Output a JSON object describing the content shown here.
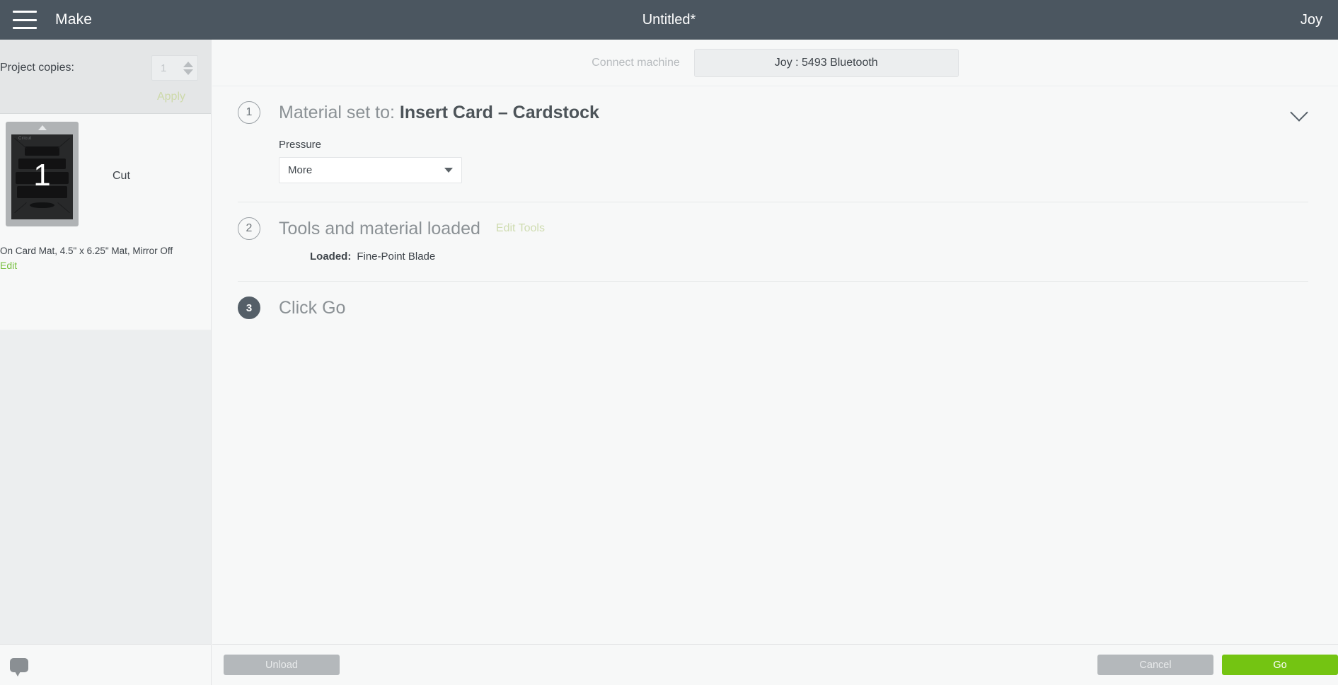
{
  "topbar": {
    "menu_icon": "hamburger-icon",
    "app_title": "Make",
    "document_title": "Untitled*",
    "machine_name": "Joy"
  },
  "left_panel": {
    "copies_label": "Project copies:",
    "copies_value": "1",
    "apply_label": "Apply",
    "mat": {
      "number": "1",
      "operation": "Cut",
      "brand": "Cricut",
      "description": "On Card Mat, 4.5\" x 6.25\" Mat, Mirror Off",
      "edit_label": "Edit"
    },
    "chat_icon": "chat-bubble-icon"
  },
  "connect": {
    "label": "Connect machine",
    "selected_machine": "Joy : 5493 Bluetooth"
  },
  "steps": [
    {
      "number": "1",
      "title_prefix": "Material set to:",
      "title_value": "Insert Card – Cardstock",
      "collapse_icon": "chevron-down-icon",
      "pressure_label": "Pressure",
      "pressure_value": "More"
    },
    {
      "number": "2",
      "title": "Tools and material loaded",
      "edit_tools_label": "Edit Tools",
      "loaded_label": "Loaded:",
      "loaded_value": "Fine-Point Blade"
    },
    {
      "number": "3",
      "title": "Click Go"
    }
  ],
  "bottombar": {
    "unload_label": "Unload",
    "cancel_label": "Cancel",
    "go_label": "Go"
  },
  "colors": {
    "topbar": "#4b5660",
    "go_green": "#74c412",
    "link_green": "#7ac143",
    "disabled_gray": "#b4b8bb"
  }
}
